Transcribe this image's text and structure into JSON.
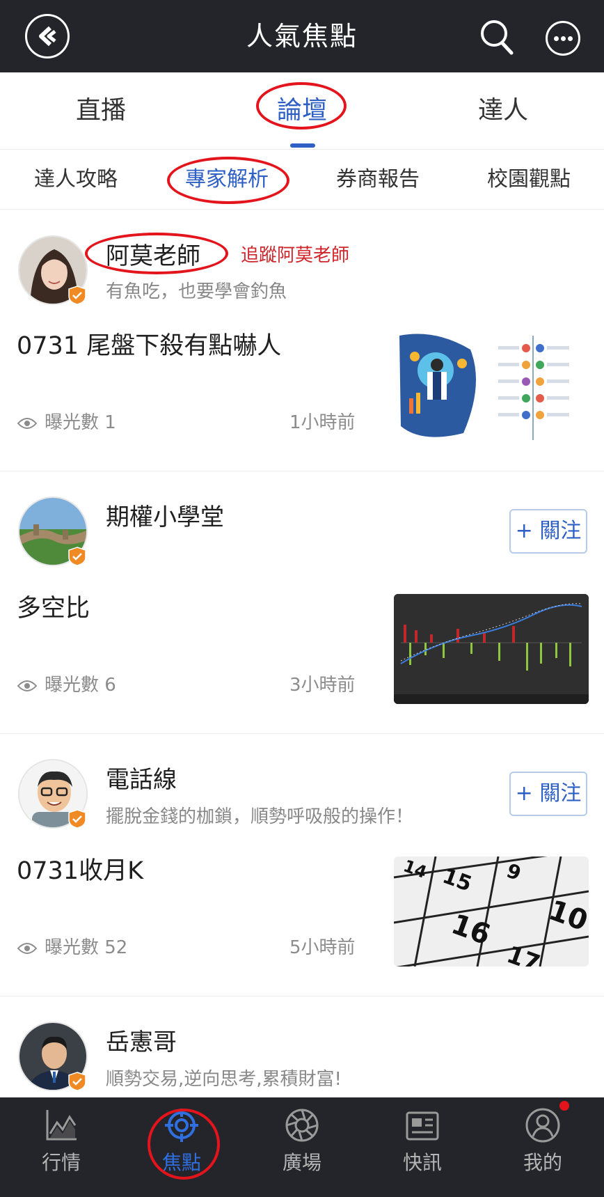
{
  "header": {
    "title": "人氣焦點",
    "back_icon": "back-arrow-icon",
    "search_icon": "search-icon",
    "more_icon": "more-dots-icon"
  },
  "main_tabs": [
    {
      "label": "直播",
      "active": false
    },
    {
      "label": "論壇",
      "active": true
    },
    {
      "label": "達人",
      "active": false
    }
  ],
  "sub_tabs": [
    {
      "label": "達人攻略",
      "active": false
    },
    {
      "label": "專家解析",
      "active": true
    },
    {
      "label": "券商報告",
      "active": false
    },
    {
      "label": "校園觀點",
      "active": false
    }
  ],
  "posts": [
    {
      "author": "阿莫老師",
      "follow_text": "追蹤阿莫老師",
      "bio": "有魚吃，也要學會釣魚",
      "title": "0731 尾盤下殺有點嚇人",
      "views_label": "曝光數 1",
      "time": "1小時前"
    },
    {
      "author": "期權小學堂",
      "follow_button": "+ 關注",
      "bio": "",
      "title": "多空比",
      "views_label": "曝光數 6",
      "time": "3小時前"
    },
    {
      "author": "電話線",
      "follow_button": "+ 關注",
      "bio": "擺脫金錢的枷鎖，順勢呼吸般的操作！",
      "title": "0731收月K",
      "views_label": "曝光數 52",
      "time": "5小時前"
    },
    {
      "author": "岳憲哥",
      "bio": "順勢交易,逆向思考,累積財富!"
    }
  ],
  "bottom_nav": [
    {
      "label": "行情",
      "icon": "market-chart-icon",
      "active": false
    },
    {
      "label": "焦點",
      "icon": "focus-target-icon",
      "active": true
    },
    {
      "label": "廣場",
      "icon": "aperture-icon",
      "active": false
    },
    {
      "label": "快訊",
      "icon": "news-icon",
      "active": false
    },
    {
      "label": "我的",
      "icon": "profile-icon",
      "active": false
    }
  ],
  "colors": {
    "bar_bg": "#24252a",
    "accent_blue": "#2d5fc4",
    "annotation_red": "#e3141c",
    "verified_orange": "#f08a24"
  }
}
